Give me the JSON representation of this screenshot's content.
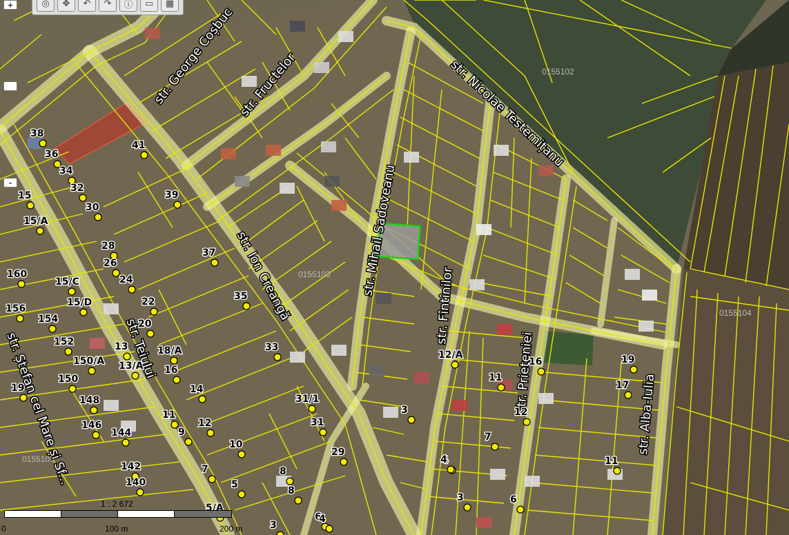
{
  "toolbar": {
    "tools": [
      {
        "name": "zoom-tool-icon",
        "glyph": "◎"
      },
      {
        "name": "pan-tool-icon",
        "glyph": "✥"
      },
      {
        "name": "back-tool-icon",
        "glyph": "↶"
      },
      {
        "name": "forward-tool-icon",
        "glyph": "↷"
      },
      {
        "name": "info-tool-icon",
        "glyph": "ⓘ"
      },
      {
        "name": "print-tool-icon",
        "glyph": "▭"
      },
      {
        "name": "table-tool-icon",
        "glyph": "▦"
      }
    ]
  },
  "zoom": {
    "in_label": "+",
    "mid_label": "",
    "out_label": "-"
  },
  "parcels": [
    {
      "label": "0155102"
    },
    {
      "label": "0155103"
    },
    {
      "label": "0155104"
    },
    {
      "label": "0155109"
    }
  ],
  "streets": [
    {
      "label": "str. George Coșbuc"
    },
    {
      "label": "str. Fructelor"
    },
    {
      "label": "str. Nicolae Testemițanu"
    },
    {
      "label": "str. Mihail Sadoveanu"
    },
    {
      "label": "str. Ion Creangă"
    },
    {
      "label": "str. Fîntînilor"
    },
    {
      "label": "str. Prieteniei"
    },
    {
      "label": "str. Alba-Iulia"
    },
    {
      "label": "str. Teiului"
    },
    {
      "label": "str. Ștefan cel Mare și Sf..."
    }
  ],
  "addresses": [
    "38",
    "36",
    "34",
    "32",
    "30",
    "15",
    "15/A",
    "41",
    "39",
    "28",
    "26",
    "24",
    "22",
    "20",
    "160",
    "15/C",
    "15/D",
    "156",
    "154",
    "152",
    "150/A",
    "13",
    "13/A",
    "18/A",
    "16",
    "14",
    "150",
    "148",
    "146",
    "144",
    "19",
    "11",
    "9",
    "12",
    "142",
    "140",
    "8",
    "7",
    "5",
    "5/A",
    "37",
    "35",
    "33",
    "31/1",
    "31",
    "29",
    "10",
    "8",
    "6",
    "4",
    "3",
    "4",
    "12/A",
    "16",
    "19",
    "11",
    "17",
    "12",
    "3",
    "7",
    "4",
    "3",
    "6",
    "11"
  ],
  "scale": {
    "ratio": "1 : 2 672",
    "zero": "0",
    "mid": "100 m",
    "end": "200 m"
  },
  "colors": {
    "parcel_line": "#e6e600",
    "road": "#eef2a0",
    "selected": "#19d219",
    "highlight": "#c42f22",
    "marker": "#f2ea00"
  }
}
